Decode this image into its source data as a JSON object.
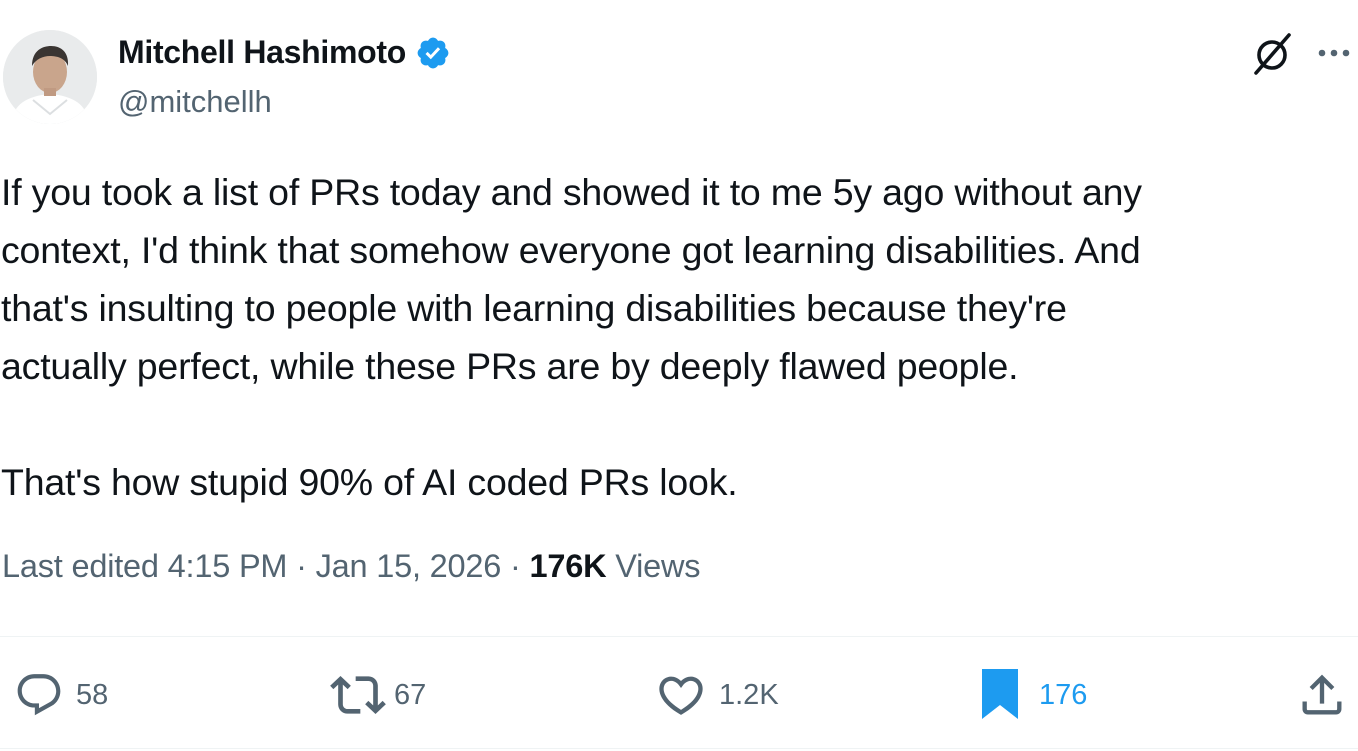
{
  "author": {
    "name": "Mitchell Hashimoto",
    "handle": "@mitchellh",
    "verified": true,
    "avatar_icon": "avatar-photo"
  },
  "header_actions": {
    "grok_icon": "grok-icon",
    "more_icon": "more-icon"
  },
  "tweet": {
    "paragraphs": [
      {
        "lines": [
          "If you took a list of PRs today and showed it to me 5y ago without any",
          "context, I'd think that somehow everyone got learning disabilities. And",
          "that's insulting to people with learning disabilities because they're",
          "actually perfect, while these PRs are by deeply flawed people."
        ]
      },
      {
        "lines": [
          "That's how stupid 90% of AI coded PRs look."
        ]
      }
    ]
  },
  "meta": {
    "edited_label": "Last edited",
    "time": "4:15 PM",
    "date": "Jan 15, 2026",
    "separator": "·",
    "views_count": "176K",
    "views_label": "Views"
  },
  "actions": {
    "replies": {
      "icon": "reply-icon",
      "count": "58"
    },
    "reposts": {
      "icon": "repost-icon",
      "count": "67"
    },
    "likes": {
      "icon": "like-icon",
      "count": "1.2K"
    },
    "bookmarks": {
      "icon": "bookmark-icon",
      "count": "176",
      "active": true
    },
    "share": {
      "icon": "share-icon"
    }
  },
  "colors": {
    "text_primary": "#0f1419",
    "text_secondary": "#536471",
    "accent": "#1d9bf0",
    "divider": "#eff3f4"
  }
}
